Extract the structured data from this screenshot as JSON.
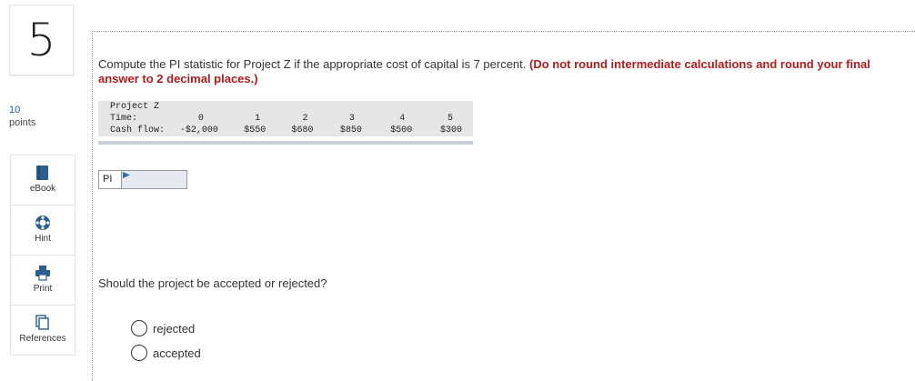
{
  "question_number": "5",
  "points": {
    "value": "10",
    "label": "points"
  },
  "tools": [
    {
      "label": "eBook",
      "icon": "book-icon"
    },
    {
      "label": "Hint",
      "icon": "lifebuoy-icon"
    },
    {
      "label": "Print",
      "icon": "printer-icon"
    },
    {
      "label": "References",
      "icon": "references-icon"
    }
  ],
  "question": {
    "text": "Compute the PI statistic for Project Z if the appropriate cost of capital is 7 percent. ",
    "note": "(Do not round intermediate calculations and round your final answer to 2 decimal places.)"
  },
  "cash_flow_table": {
    "title": "Project Z",
    "row_time_label": "Time:",
    "times": [
      "0",
      "1",
      "2",
      "3",
      "4",
      "5"
    ],
    "row_cash_label": "Cash flow:",
    "cash_flows": [
      "-$2,000",
      "$550",
      "$680",
      "$850",
      "$500",
      "$300"
    ]
  },
  "pi_field": {
    "label": "PI",
    "value": ""
  },
  "question2": "Should the project be accepted or rejected?",
  "options": [
    {
      "label": "rejected"
    },
    {
      "label": "accepted"
    }
  ],
  "colors": {
    "accent": "#2b5d8e",
    "note_red": "#b31b1b",
    "table_bg": "#e6e6e6"
  }
}
